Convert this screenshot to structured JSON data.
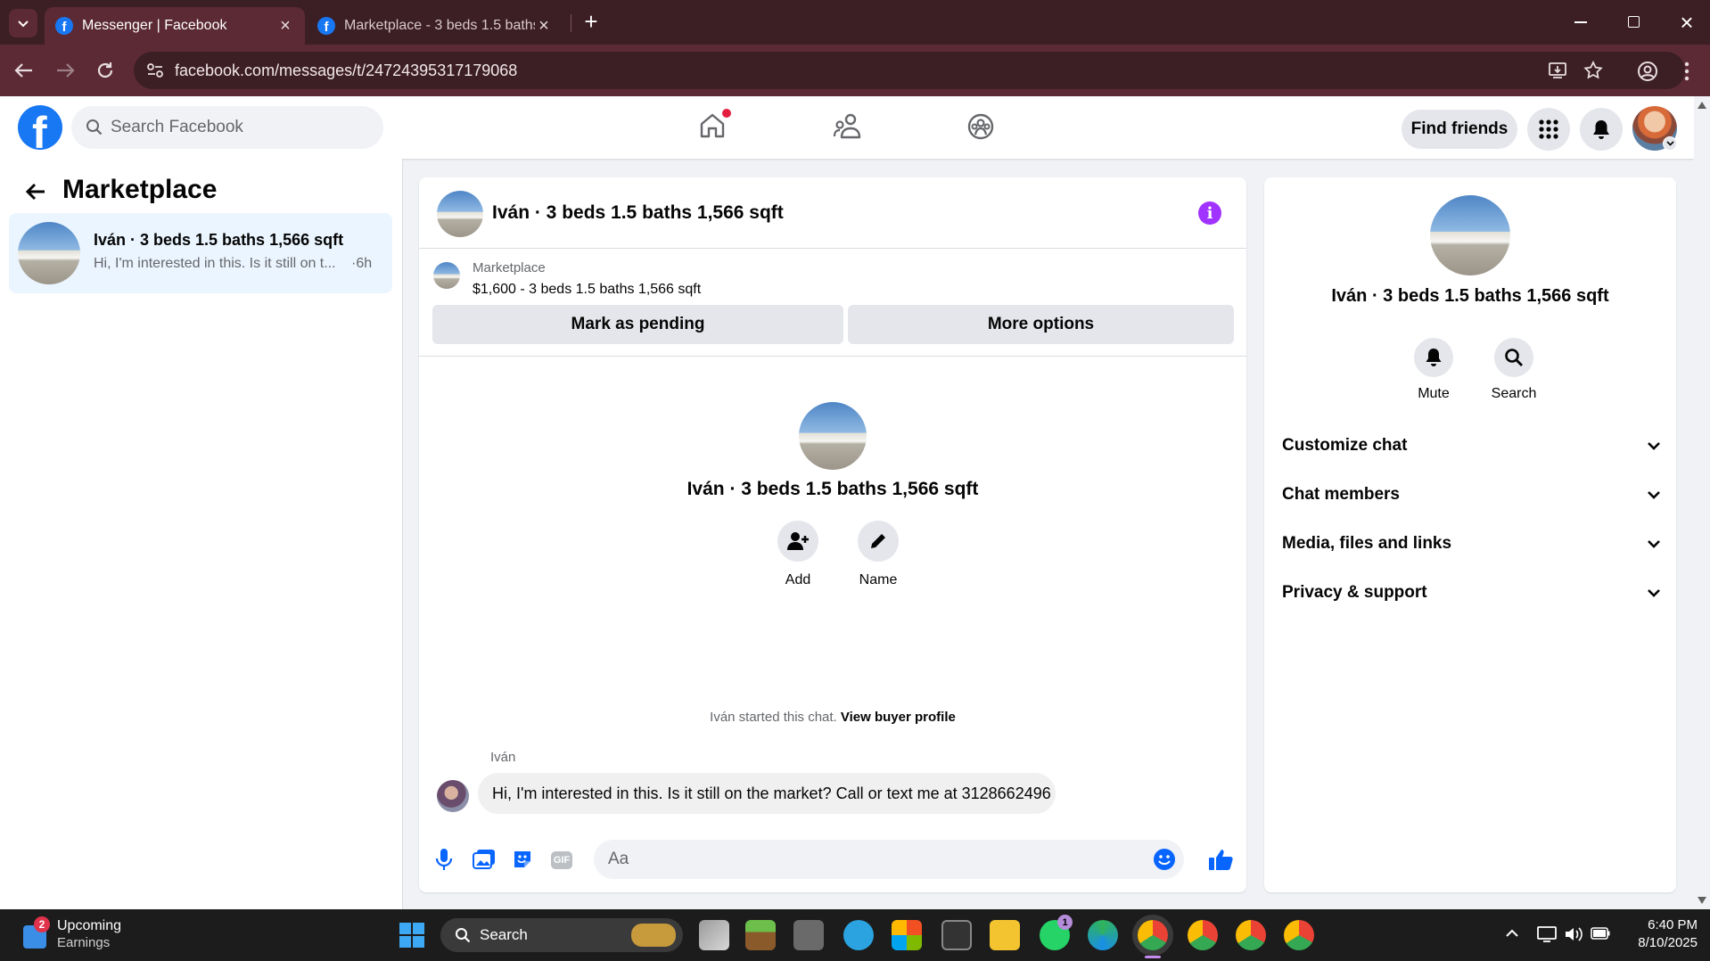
{
  "browser": {
    "tabs": [
      {
        "title": "Messenger | Facebook",
        "active": true
      },
      {
        "title": "Marketplace - 3 beds 1.5 baths",
        "active": false
      }
    ],
    "url": "facebook.com/messages/t/24724395317179068"
  },
  "header": {
    "search_placeholder": "Search Facebook",
    "find_friends": "Find friends"
  },
  "sidebar": {
    "title": "Marketplace",
    "conversations": [
      {
        "name": "Iván · 3 beds 1.5 baths 1,566 sqft",
        "preview": "Hi, I'm interested in this. Is it still on t...",
        "time": "·6h"
      }
    ]
  },
  "chat": {
    "title": "Iván · 3 beds 1.5 baths 1,566 sqft",
    "listing": {
      "source": "Marketplace",
      "summary": "$1,600 - 3 beds 1.5 baths 1,566 sqft"
    },
    "mark_pending": "Mark as pending",
    "more_options": "More options",
    "intro_name": "Iván · 3 beds 1.5 baths 1,566 sqft",
    "add_label": "Add",
    "name_label": "Name",
    "started_text": "Iván started this chat.",
    "view_profile": "View buyer profile",
    "sender": "Iván",
    "message": "Hi, I'm interested in this. Is it still on the market? Call or text me at 3128662496",
    "composer_placeholder": "Aa",
    "gif_label": "GIF"
  },
  "details": {
    "name": "Iván · 3 beds 1.5 baths 1,566 sqft",
    "mute": "Mute",
    "search": "Search",
    "sections": [
      "Customize chat",
      "Chat members",
      "Media, files and links",
      "Privacy & support"
    ]
  },
  "taskbar": {
    "widget_title": "Upcoming",
    "widget_subtitle": "Earnings",
    "widget_badge": "2",
    "search": "Search",
    "whatsapp_badge": "1",
    "time": "6:40 PM",
    "date": "8/10/2025"
  },
  "colors": {
    "fb_blue": "#1877f2",
    "accent_purple": "#a033ff",
    "chrome_dark": "#3c1e25",
    "chrome_mid": "#5c2a35"
  }
}
